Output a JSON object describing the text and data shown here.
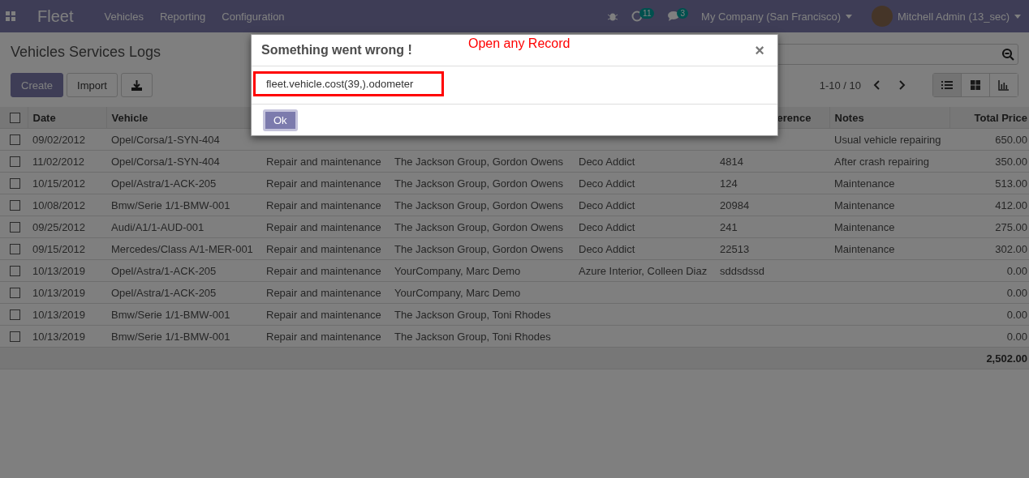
{
  "navbar": {
    "app_name": "Fleet",
    "menu": [
      "Vehicles",
      "Reporting",
      "Configuration"
    ],
    "activity_count": "11",
    "message_count": "3",
    "company": "My Company (San Francisco)",
    "user": "Mitchell Admin (13_sec)"
  },
  "control_panel": {
    "title": "Vehicles Services Logs",
    "buttons": [
      "Create",
      "Import"
    ],
    "pager": "1-10 / 10",
    "views": [
      {
        "kind": "list",
        "selected": true
      },
      {
        "kind": "kanban",
        "selected": false
      },
      {
        "kind": "graph",
        "selected": false
      }
    ]
  },
  "table": {
    "header": {
      "checked": false,
      "date": "Date",
      "vehicle": "Vehicle",
      "reference": "erence",
      "notes": "Notes",
      "total_price": "Total Price"
    },
    "rows": [
      {
        "checked": false,
        "date": "09/02/2012",
        "vehicle": "Opel/Corsa/1-SYN-404",
        "notes": "Usual vehicle repairing",
        "total_price": "650.00"
      },
      {
        "checked": false,
        "date": "11/02/2012",
        "vehicle": "Opel/Corsa/1-SYN-404",
        "service_type": "Repair and maintenance",
        "vendor": "The Jackson Group, Gordon Owens",
        "purchaser": "Deco Addict",
        "reference": "4814",
        "notes": "After crash repairing",
        "total_price": "350.00"
      },
      {
        "checked": false,
        "date": "10/15/2012",
        "vehicle": "Opel/Astra/1-ACK-205",
        "service_type": "Repair and maintenance",
        "vendor": "The Jackson Group, Gordon Owens",
        "purchaser": "Deco Addict",
        "reference": "124",
        "notes": "Maintenance",
        "total_price": "513.00"
      },
      {
        "checked": false,
        "date": "10/08/2012",
        "vehicle": "Bmw/Serie 1/1-BMW-001",
        "service_type": "Repair and maintenance",
        "vendor": "The Jackson Group, Gordon Owens",
        "purchaser": "Deco Addict",
        "reference": "20984",
        "notes": "Maintenance",
        "total_price": "412.00"
      },
      {
        "checked": false,
        "date": "09/25/2012",
        "vehicle": "Audi/A1/1-AUD-001",
        "service_type": "Repair and maintenance",
        "vendor": "The Jackson Group, Gordon Owens",
        "purchaser": "Deco Addict",
        "reference": "241",
        "notes": "Maintenance",
        "total_price": "275.00"
      },
      {
        "checked": false,
        "date": "09/15/2012",
        "vehicle": "Mercedes/Class A/1-MER-001",
        "service_type": "Repair and maintenance",
        "vendor": "The Jackson Group, Gordon Owens",
        "purchaser": "Deco Addict",
        "reference": "22513",
        "notes": "Maintenance",
        "total_price": "302.00"
      },
      {
        "checked": false,
        "date": "10/13/2019",
        "vehicle": "Opel/Astra/1-ACK-205",
        "service_type": "Repair and maintenance",
        "vendor": "YourCompany, Marc Demo",
        "purchaser": "Azure Interior, Colleen Diaz",
        "reference": "sddsdssd",
        "total_price": "0.00"
      },
      {
        "checked": false,
        "date": "10/13/2019",
        "vehicle": "Opel/Astra/1-ACK-205",
        "service_type": "Repair and maintenance",
        "vendor": "YourCompany, Marc Demo",
        "total_price": "0.00"
      },
      {
        "checked": false,
        "date": "10/13/2019",
        "vehicle": "Bmw/Serie 1/1-BMW-001",
        "service_type": "Repair and maintenance",
        "vendor": "The Jackson Group, Toni Rhodes",
        "total_price": "0.00"
      },
      {
        "checked": false,
        "date": "10/13/2019",
        "vehicle": "Bmw/Serie 1/1-BMW-001",
        "service_type": "Repair and maintenance",
        "vendor": "The Jackson Group, Toni Rhodes",
        "total_price": "0.00"
      }
    ],
    "total": "2,502.00"
  },
  "dialog": {
    "title": "Something went wrong !",
    "annotation": "Open any Record",
    "close": "×",
    "message": "fleet.vehicle.cost(39,).odometer",
    "button": "Ok"
  }
}
